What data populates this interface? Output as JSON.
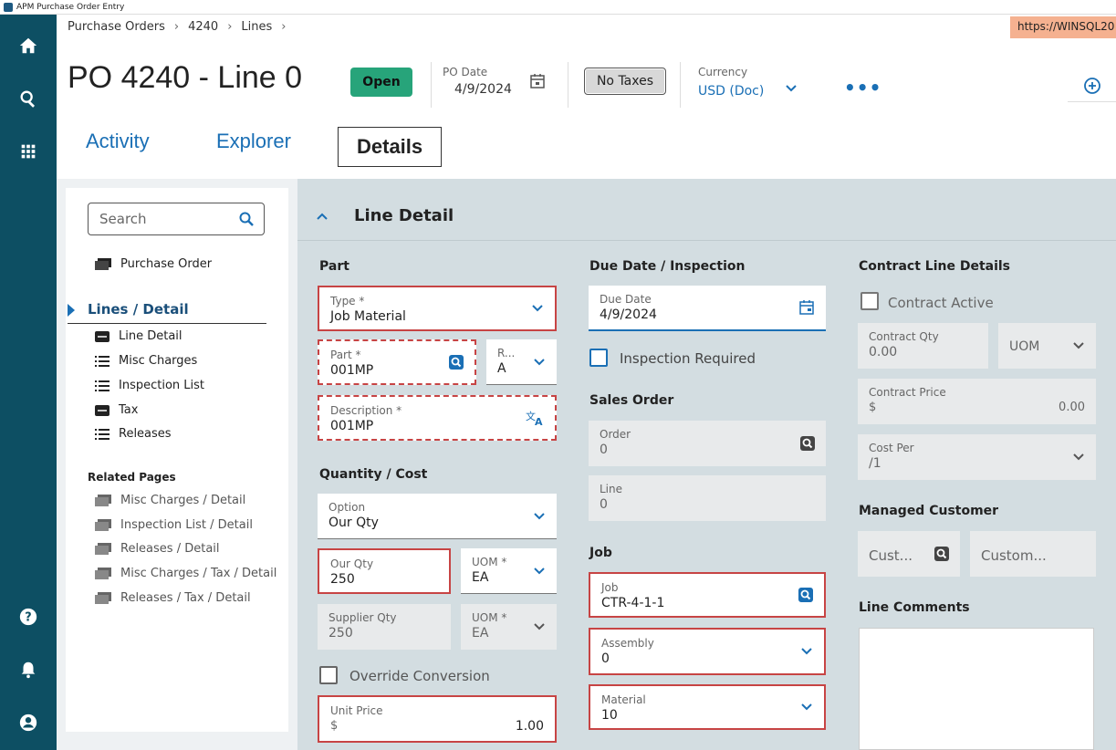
{
  "window": {
    "title": "APM Purchase Order Entry"
  },
  "url": "https://WINSQL20",
  "breadcrumb": {
    "items": [
      "Purchase Orders",
      "4240",
      "Lines"
    ],
    "sep": "›"
  },
  "header": {
    "title": "PO 4240 - Line 0",
    "status": "Open",
    "po_date_label": "PO Date",
    "po_date_value": "4/9/2024",
    "taxes_button": "No Taxes",
    "currency_label": "Currency",
    "currency_value": "USD (Doc)",
    "more": "•••"
  },
  "tabs": [
    "Activity",
    "Explorer",
    "Details"
  ],
  "leftpanel": {
    "search_placeholder": "Search",
    "purchase_order": "Purchase Order",
    "section": "Lines / Detail",
    "sub_items": [
      "Line Detail",
      "Misc Charges",
      "Inspection List",
      "Tax",
      "Releases"
    ],
    "related_title": "Related Pages",
    "related": [
      "Misc Charges / Detail",
      "Inspection List / Detail",
      "Releases / Detail",
      "Misc Charges / Tax / Detail",
      "Releases / Tax / Detail"
    ]
  },
  "line_detail": {
    "title": "Line Detail",
    "part": {
      "section": "Part",
      "type_label": "Type *",
      "type_value": "Job Material",
      "part_label": "Part *",
      "part_value": "001MP",
      "rev_label": "R...",
      "rev_value": "A",
      "desc_label": "Description *",
      "desc_value": "001MP"
    },
    "qty": {
      "section": "Quantity / Cost",
      "option_label": "Option",
      "option_value": "Our Qty",
      "ourqty_label": "Our Qty",
      "ourqty_value": "250",
      "uom_label": "UOM *",
      "uom_value": "EA",
      "supqty_label": "Supplier Qty",
      "supqty_value": "250",
      "supuom_label": "UOM *",
      "supuom_value": "EA",
      "override_label": "Override Conversion",
      "unitprice_label": "Unit Price",
      "unitprice_currency": "$",
      "unitprice_value": "1.00"
    },
    "due": {
      "section": "Due Date / Inspection",
      "due_label": "Due Date",
      "due_value": "4/9/2024",
      "inspection_label": "Inspection Required"
    },
    "sales": {
      "section": "Sales Order",
      "order_label": "Order",
      "order_value": "0",
      "line_label": "Line",
      "line_value": "0"
    },
    "job": {
      "section": "Job",
      "job_label": "Job",
      "job_value": "CTR-4-1-1",
      "assembly_label": "Assembly",
      "assembly_value": "0",
      "material_label": "Material",
      "material_value": "10"
    },
    "contract": {
      "section": "Contract Line Details",
      "active_label": "Contract Active",
      "qty_label": "Contract Qty",
      "qty_value": "0.00",
      "uom_value": "UOM",
      "price_label": "Contract Price",
      "price_currency": "$",
      "price_value": "0.00",
      "costper_label": "Cost Per",
      "costper_value": "/1"
    },
    "managed": {
      "section": "Managed Customer",
      "cust_label": "Cust...",
      "custom_label": "Custom..."
    },
    "comments": {
      "section": "Line Comments"
    }
  },
  "colors": {
    "nav": "#0d4f63",
    "accent": "#1a6fb5",
    "status": "#27a47a",
    "required": "#c74444",
    "panel": "#d3dde1"
  }
}
